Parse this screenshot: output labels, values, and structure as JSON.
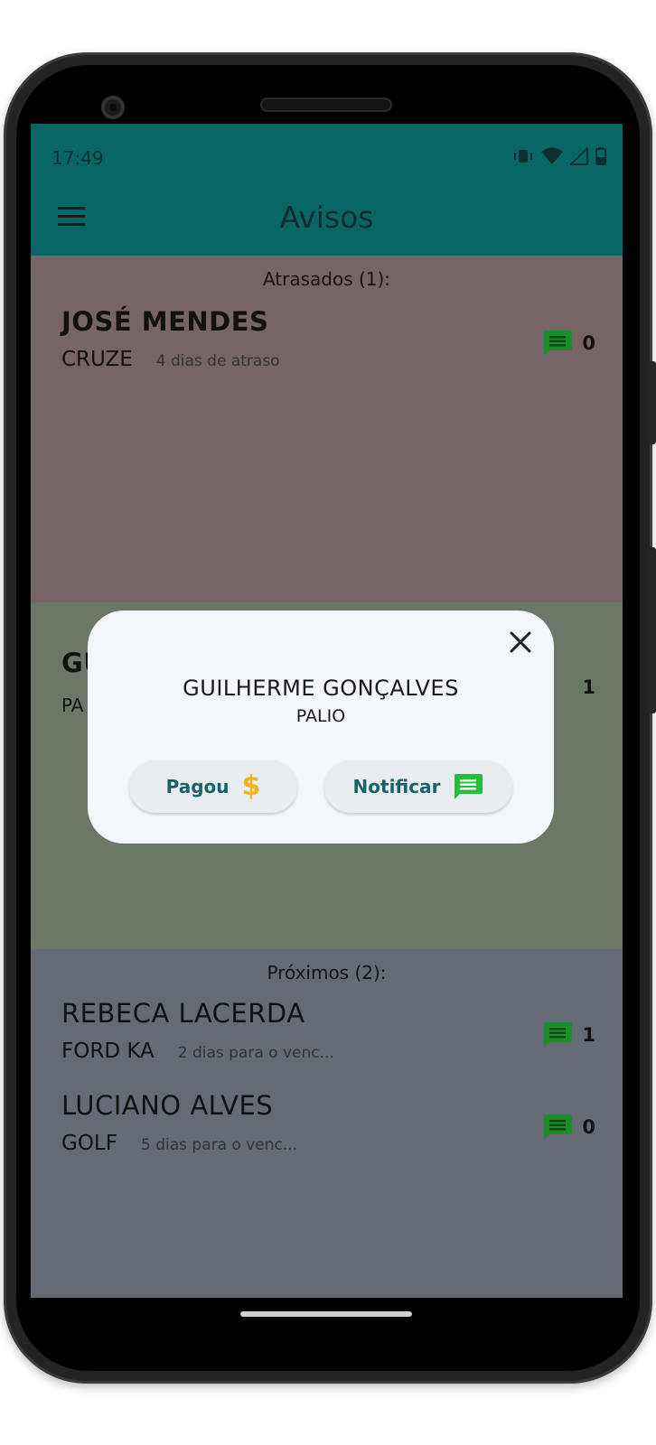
{
  "status_bar": {
    "time": "17:49"
  },
  "app_bar": {
    "title": "Avisos",
    "menu_icon": "hamburger-menu-icon"
  },
  "sections": {
    "atrasados": {
      "header": "Atrasados (1):",
      "color": "#776565",
      "items": [
        {
          "name": "JOSÉ MENDES",
          "car": "CRUZE",
          "note": "4 dias de atraso",
          "messages": "0"
        }
      ]
    },
    "hoje": {
      "color": "#6b7868",
      "items": [
        {
          "name_fragment": "GU",
          "car_fragment": "PA",
          "messages": "1"
        }
      ]
    },
    "proximos": {
      "header": "Próximos (2):",
      "color": "#656b75",
      "items": [
        {
          "name": "REBECA LACERDA",
          "car": "FORD KA",
          "note": "2 dias para o venc...",
          "messages": "1"
        },
        {
          "name": "LUCIANO ALVES",
          "car": "GOLF",
          "note": "5 dias para o venc...",
          "messages": "0"
        }
      ]
    }
  },
  "dialog": {
    "name": "GUILHERME GONÇALVES",
    "car": "PALIO",
    "pay_button": "Pagou",
    "notify_button": "Notificar",
    "close_icon": "close-icon"
  },
  "colors": {
    "app_bar": "#086666",
    "message_icon": "#1e8c2a",
    "notify_icon": "#22c03a",
    "dollar_icon": "#f3b51c",
    "button_text": "#17636b"
  }
}
